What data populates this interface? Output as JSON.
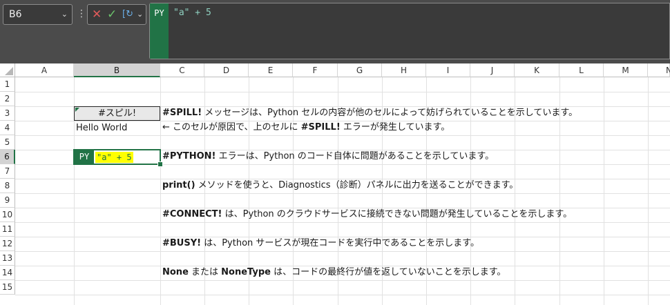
{
  "name_box": {
    "value": "B6"
  },
  "formula_bar": {
    "cancel_icon": "✕",
    "enter_icon": "✓",
    "python_icon": "python-insert-icon",
    "language_badge": "PY",
    "formula": "\"a\" + 5"
  },
  "columns": [
    "A",
    "B",
    "C",
    "D",
    "E",
    "F",
    "G",
    "H",
    "I",
    "J",
    "K",
    "L",
    "M",
    "N"
  ],
  "selected_column": "B",
  "rows": [
    "1",
    "2",
    "3",
    "4",
    "5",
    "6",
    "7",
    "8",
    "9",
    "10",
    "11",
    "12",
    "13",
    "14",
    "15"
  ],
  "selected_row": "6",
  "cells": {
    "B3": "#スピル!",
    "B4": "Hello World",
    "B6": {
      "badge": "PY",
      "expr": "\"a\" + 5"
    },
    "C3": {
      "bold": "#SPILL!",
      "rest": " メッセージは、Python セルの内容が他のセルによって妨げられていることを示しています。"
    },
    "C4": {
      "pre": "← このセルが原因で、上のセルに ",
      "bold": "#SPILL!",
      "rest": " エラーが発生しています。"
    },
    "C6": {
      "bold": "#PYTHON!",
      "rest": " エラーは、Python のコード自体に問題があることを示しています。"
    },
    "C8": {
      "bold": "print()",
      "rest": " メソッドを使うと、Diagnostics（診断）パネルに出力を送ることができます。"
    },
    "C10": {
      "bold": "#CONNECT!",
      "rest": " は、Python のクラウドサービスに接続できない問題が発生していることを示します。"
    },
    "C12": {
      "bold": "#BUSY!",
      "rest": " は、Python サービスが現在コードを実行中であることを示します。"
    },
    "C14": {
      "bold": "None",
      "mid": " または ",
      "bold2": "NoneType",
      "rest": " は、コードの最終行が値を返していないことを示します。"
    }
  },
  "colors": {
    "accent": "#217346",
    "highlight": "#ffff00",
    "spill_bg": "#e8e8e8"
  }
}
